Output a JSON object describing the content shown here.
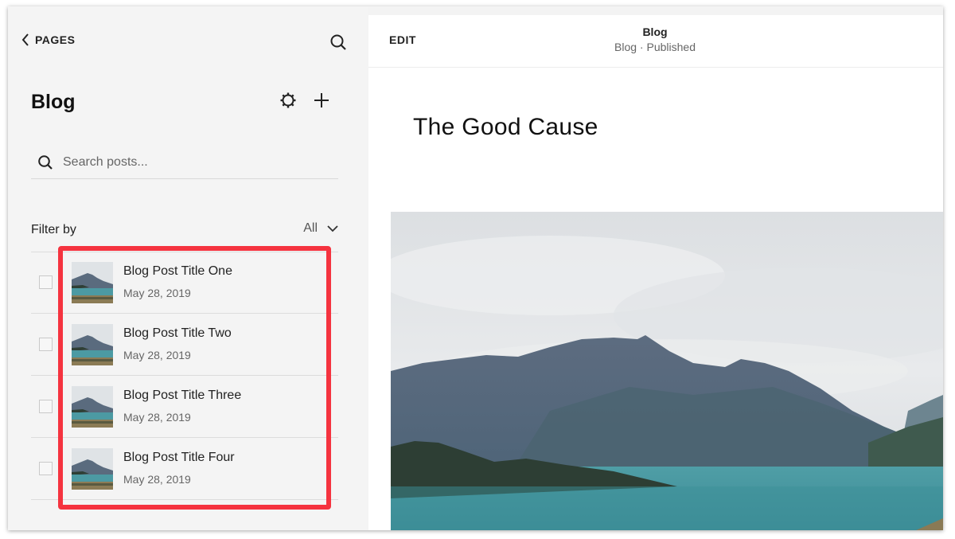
{
  "sidebar": {
    "back_label": "PAGES",
    "title": "Blog",
    "search_placeholder": "Search posts...",
    "filter": {
      "label": "Filter by",
      "selected": "All"
    },
    "posts": [
      {
        "title": "Blog Post Title One",
        "date": "May 28, 2019"
      },
      {
        "title": "Blog Post Title Two",
        "date": "May 28, 2019"
      },
      {
        "title": "Blog Post Title Three",
        "date": "May 28, 2019"
      },
      {
        "title": "Blog Post Title Four",
        "date": "May 28, 2019"
      }
    ]
  },
  "preview": {
    "edit_label": "EDIT",
    "header_title": "Blog",
    "header_subtitle": "Blog · Published",
    "page_heading": "The Good Cause"
  },
  "icons": {
    "back": "chevron-left-icon",
    "search": "search-icon",
    "settings": "gear-icon",
    "add": "plus-icon",
    "filter_dropdown": "chevron-down-icon"
  },
  "colors": {
    "highlight": "#f5333f",
    "sidebar_bg": "#f4f4f4",
    "preview_bg": "#ffffff"
  }
}
